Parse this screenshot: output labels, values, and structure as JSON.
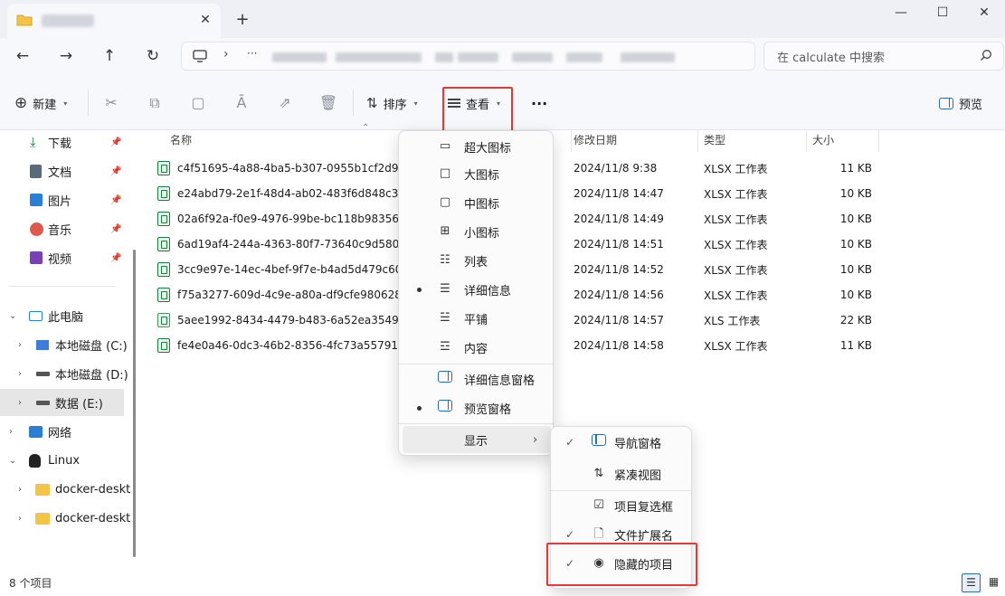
{
  "titlebar": {
    "new_tab_glyph": "+",
    "close_tab_glyph": "✕",
    "minimize_glyph": "—",
    "maximize_glyph": "☐",
    "close_glyph": "✕"
  },
  "nav": {
    "back_glyph": "←",
    "forward_glyph": "→",
    "up_glyph": "↑",
    "refresh_glyph": "↻",
    "address_sep": "›",
    "address_ellipsis": "···",
    "search_placeholder": "在 calculate 中搜索"
  },
  "toolbar": {
    "new_label": "新建",
    "sort_label": "排序",
    "view_label": "查看",
    "more_label": "···",
    "preview_label": "预览"
  },
  "sidebar": {
    "quick_items": [
      {
        "label": "下载",
        "icon": "download-icon"
      },
      {
        "label": "文档",
        "icon": "document-icon"
      },
      {
        "label": "图片",
        "icon": "picture-icon"
      },
      {
        "label": "音乐",
        "icon": "music-icon"
      },
      {
        "label": "视频",
        "icon": "video-icon"
      }
    ],
    "this_pc": "此电脑",
    "drives": [
      "本地磁盘 (C:)",
      "本地磁盘 (D:)",
      "数据 (E:)"
    ],
    "network": "网络",
    "linux": "Linux",
    "linux_children": [
      "docker-deskt",
      "docker-deskt"
    ]
  },
  "columns": {
    "name": "名称",
    "modified": "修改日期",
    "type": "类型",
    "size": "大小"
  },
  "files": [
    {
      "name": "c4f51695-4a88-4ba5-b307-0955b1cf2d95_",
      "date": "2024/11/8 9:38",
      "type": "XLSX 工作表",
      "size": "11 KB"
    },
    {
      "name": "e24abd79-2e1f-48d4-ab02-483f6d848c34_",
      "date": "2024/11/8 14:47",
      "type": "XLSX 工作表",
      "size": "10 KB"
    },
    {
      "name": "02a6f92a-f0e9-4976-99be-bc118b98356e_",
      "date": "2024/11/8 14:49",
      "type": "XLSX 工作表",
      "size": "10 KB"
    },
    {
      "name": "6ad19af4-244a-4363-80f7-73640c9d580c_",
      "date": "2024/11/8 14:51",
      "type": "XLSX 工作表",
      "size": "10 KB"
    },
    {
      "name": "3cc9e97e-14ec-4bef-9f7e-b4ad5d479c60_",
      "date": "2024/11/8 14:52",
      "type": "XLSX 工作表",
      "size": "10 KB"
    },
    {
      "name": "f75a3277-609d-4c9e-a80a-df9cfe980628_",
      "date": "2024/11/8 14:56",
      "type": "XLSX 工作表",
      "size": "10 KB"
    },
    {
      "name": "5aee1992-8434-4479-b483-6a52ea354911",
      "date": "2024/11/8 14:57",
      "type": "XLS 工作表",
      "size": "22 KB"
    },
    {
      "name": "fe4e0a46-0dc3-46b2-8356-4fc73a557915_",
      "date": "2024/11/8 14:58",
      "type": "XLSX 工作表",
      "size": "11 KB"
    }
  ],
  "view_menu": {
    "items": [
      {
        "label": "超大图标",
        "icon": "extra-large-icons-icon",
        "selected": false
      },
      {
        "label": "大图标",
        "icon": "large-icons-icon",
        "selected": false
      },
      {
        "label": "中图标",
        "icon": "medium-icons-icon",
        "selected": false
      },
      {
        "label": "小图标",
        "icon": "small-icons-icon",
        "selected": false
      },
      {
        "label": "列表",
        "icon": "list-icon",
        "selected": false
      },
      {
        "label": "详细信息",
        "icon": "details-icon",
        "selected": true
      },
      {
        "label": "平铺",
        "icon": "tiles-icon",
        "selected": false
      },
      {
        "label": "内容",
        "icon": "content-icon",
        "selected": false
      }
    ],
    "details_pane": "详细信息窗格",
    "preview_pane": "预览窗格",
    "show": "显示"
  },
  "show_menu": {
    "items": [
      {
        "label": "导航窗格",
        "checked": true
      },
      {
        "label": "紧凑视图",
        "checked": false
      },
      {
        "label": "项目复选框",
        "checked": false
      },
      {
        "label": "文件扩展名",
        "checked": true
      },
      {
        "label": "隐藏的项目",
        "checked": true
      }
    ]
  },
  "status": {
    "item_count": "8 个项目"
  },
  "colors": {
    "highlight_box": "#e53935",
    "accent": "#2b6cb0"
  }
}
